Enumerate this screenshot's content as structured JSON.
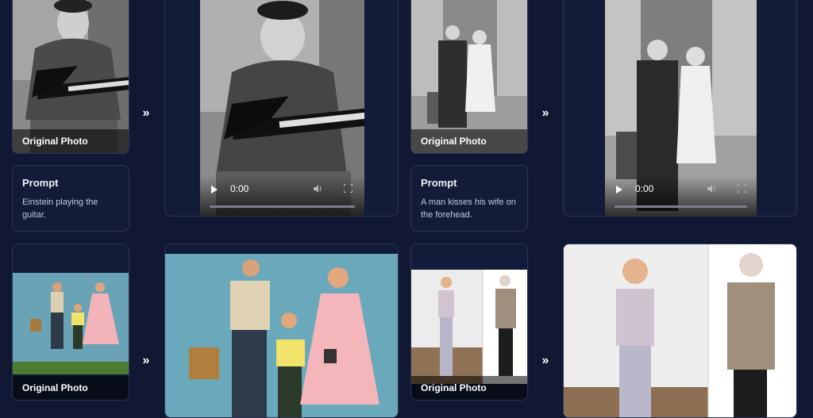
{
  "captions": {
    "original_photo_1": "Original Photo",
    "original_photo_2": "Original Photo",
    "original_photo_3": "Original Photo",
    "original_photo_4": "Original Photo"
  },
  "prompts": [
    {
      "title": "Prompt",
      "text": "Einstein playing the guitar."
    },
    {
      "title": "Prompt",
      "text": "A man kisses his wife on the forehead."
    }
  ],
  "arrow_glyph": "»",
  "videos": [
    {
      "time": "0:00"
    },
    {
      "time": "0:00"
    }
  ],
  "colors": {
    "background": "#101833",
    "card_border": "#2c3656",
    "caption_bg": "rgba(0,0,0,0.55)"
  }
}
